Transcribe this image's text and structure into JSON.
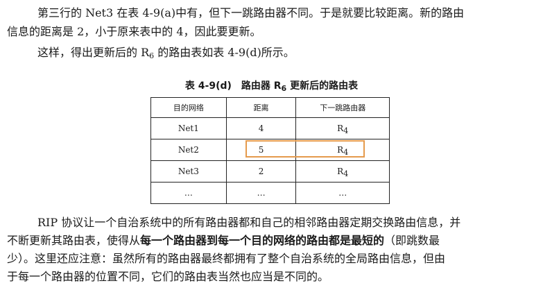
{
  "para1": {
    "line1": "第三行的 Net3 在表 4-9(a)中有，但下一跳路由器不同。于是就要比较距离。新的路由",
    "line2": "信息的距离是 2，小于原来表中的 4，因此要更新。"
  },
  "para2": {
    "before": "这样，得出更新后的 R",
    "sub": "6",
    "after": " 的路由表如表 4-9(d)所示。"
  },
  "table": {
    "caption_before": "表 4-9(d)　路由器 R",
    "caption_sub": "6",
    "caption_after": " 更新后的路由表",
    "headers": [
      "目的网络",
      "距离",
      "下一跳路由器"
    ],
    "rows": [
      {
        "net": "Net1",
        "dist": "4",
        "next": "R",
        "next_sub": "4"
      },
      {
        "net": "Net2",
        "dist": "5",
        "next": "R",
        "next_sub": "4"
      },
      {
        "net": "Net3",
        "dist": "2",
        "next": "R",
        "next_sub": "4"
      },
      {
        "net": "…",
        "dist": "…",
        "next": "…",
        "next_sub": ""
      }
    ],
    "highlight_color": "#e59a4c"
  },
  "para3": {
    "line1": "RIP 协议让一个自治系统中的所有路由器都和自己的相邻路由器定期交换路由信息，并",
    "line2_before": "不断更新其路由表，使得从",
    "line2_bold": "每一个路由器到每一个目的网络的路由都是最短的",
    "line2_after": "（即跳数最",
    "line3": "少）。这里还应注意：虽然所有的路由器最终都拥有了整个自治系统的全局路由信息，但由",
    "line4": "于每一个路由器的位置不同，它们的路由表当然也应当是不同的。"
  }
}
